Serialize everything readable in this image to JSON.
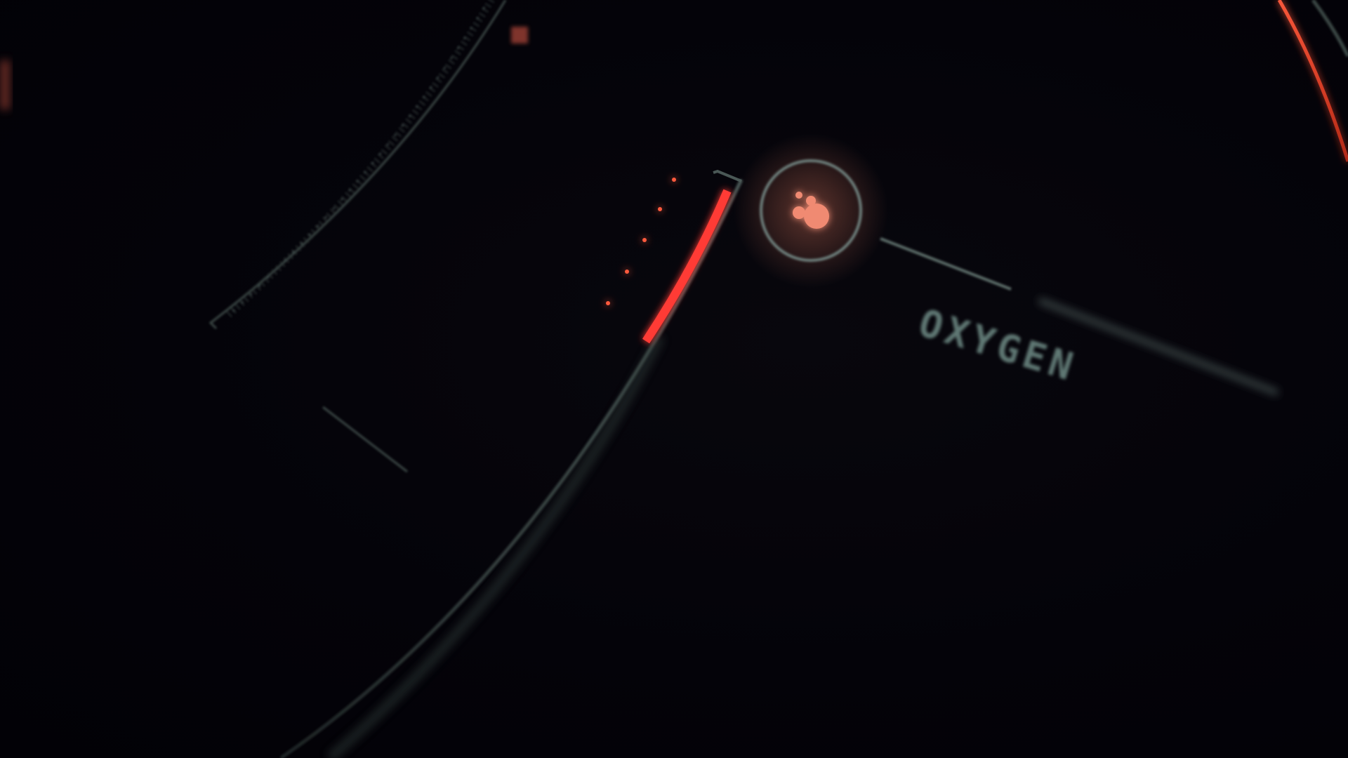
{
  "gauge": {
    "label": "OXYGEN",
    "icon": "oxygen-bubbles-icon",
    "level_fraction": 0.3
  },
  "colors": {
    "background": "#030208",
    "frame": "#3c4846",
    "accent": "#ff3b36",
    "icon": "#f08a72",
    "label": "#6f8c86"
  }
}
